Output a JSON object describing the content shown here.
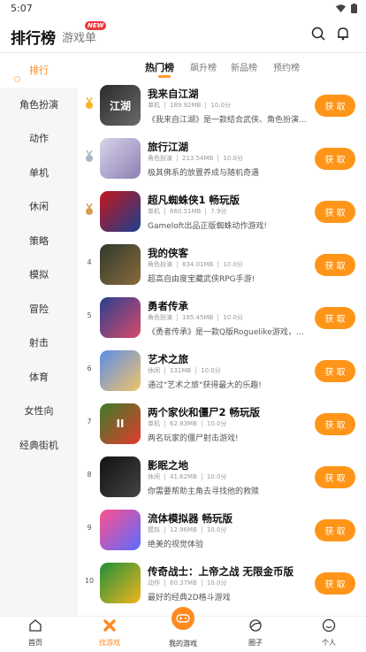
{
  "status": {
    "time": "5:07"
  },
  "header": {
    "title": "排行榜",
    "tab2": "游戏单",
    "badge": "NEW"
  },
  "sidebar": {
    "items": [
      {
        "label": "排行"
      },
      {
        "label": "角色扮演"
      },
      {
        "label": "动作"
      },
      {
        "label": "单机"
      },
      {
        "label": "休闲"
      },
      {
        "label": "策略"
      },
      {
        "label": "模拟"
      },
      {
        "label": "冒险"
      },
      {
        "label": "射击"
      },
      {
        "label": "体育"
      },
      {
        "label": "女性向"
      },
      {
        "label": "经典街机"
      }
    ]
  },
  "subtabs": [
    "热门榜",
    "飙升榜",
    "新品榜",
    "预约榜"
  ],
  "games": [
    {
      "rank": "1",
      "name": "我来自江湖",
      "category": "单机",
      "size": "189.92MB",
      "score": "10.0分",
      "desc": "《我来自江湖》是一款结合武侠、角色扮演...",
      "button": "获 取",
      "icon_colors": [
        "#2b2b2b",
        "#6a6a6a"
      ],
      "icon_text": "江湖"
    },
    {
      "rank": "2",
      "name": "旅行江湖",
      "category": "角色扮演",
      "size": "213.54MB",
      "score": "10.0分",
      "desc": "极其佛系的放置养成与随机奇遇",
      "button": "获 取",
      "icon_colors": [
        "#d9d4ea",
        "#8c7fb4"
      ],
      "icon_text": ""
    },
    {
      "rank": "3",
      "name": "超凡蜘蛛侠1 畅玩版",
      "category": "单机",
      "size": "660.51MB",
      "score": "7.9分",
      "desc": "Gameloft出品正版蜘蛛动作游戏!",
      "button": "获 取",
      "icon_colors": [
        "#c4161c",
        "#1b3f8f"
      ],
      "icon_text": ""
    },
    {
      "rank": "4",
      "name": "我的侠客",
      "category": "角色扮演",
      "size": "834.01MB",
      "score": "10.0分",
      "desc": "超高自由度宝藏武侠RPG手游!",
      "button": "获 取",
      "icon_colors": [
        "#2f3a2e",
        "#8a6b3b"
      ],
      "icon_text": ""
    },
    {
      "rank": "5",
      "name": "勇者传承",
      "category": "角色扮演",
      "size": "185.45MB",
      "score": "10.0分",
      "desc": "《勇者传承》是一款Q版Roguelike游戏，玩...",
      "button": "获 取",
      "icon_colors": [
        "#2a3f8f",
        "#d84a6a"
      ],
      "icon_text": ""
    },
    {
      "rank": "6",
      "name": "艺术之旅",
      "category": "休闲",
      "size": "131MB",
      "score": "10.0分",
      "desc": "通过\"艺术之旅\"获得最大的乐趣!",
      "button": "获 取",
      "icon_colors": [
        "#5a8de8",
        "#f2c46a"
      ],
      "icon_text": ""
    },
    {
      "rank": "7",
      "name": "两个家伙和僵尸2 畅玩版",
      "category": "单机",
      "size": "62.83MB",
      "score": "10.0分",
      "desc": "两名玩家的僵尸射击游戏!",
      "button": "获 取",
      "icon_colors": [
        "#3d7d2b",
        "#e23b2b"
      ],
      "icon_text": "II"
    },
    {
      "rank": "8",
      "name": "影眠之地",
      "category": "休闲",
      "size": "41.62MB",
      "score": "10.0分",
      "desc": "你需要帮助主角去寻找他的救赎",
      "button": "获 取",
      "icon_colors": [
        "#111111",
        "#444444"
      ],
      "icon_text": ""
    },
    {
      "rank": "9",
      "name": "流体模拟器 畅玩版",
      "category": "模拟",
      "size": "12.96MB",
      "score": "10.0分",
      "desc": "绝美的视觉体验",
      "button": "获 取",
      "icon_colors": [
        "#ff4f8b",
        "#5b6bff"
      ],
      "icon_text": ""
    },
    {
      "rank": "10",
      "name": "传奇战士：上帝之战 无限金币版",
      "category": "动作",
      "size": "60.37MB",
      "score": "10.0分",
      "desc": "最好的经典2D格斗游戏",
      "button": "获 取",
      "icon_colors": [
        "#1e8f3a",
        "#f2b51e"
      ],
      "icon_text": ""
    }
  ],
  "bottom_nav": {
    "home": "首页",
    "find": "找游戏",
    "mine": "我的游戏",
    "circle": "圈子",
    "profile": "个人"
  },
  "accent": "#ff9518"
}
